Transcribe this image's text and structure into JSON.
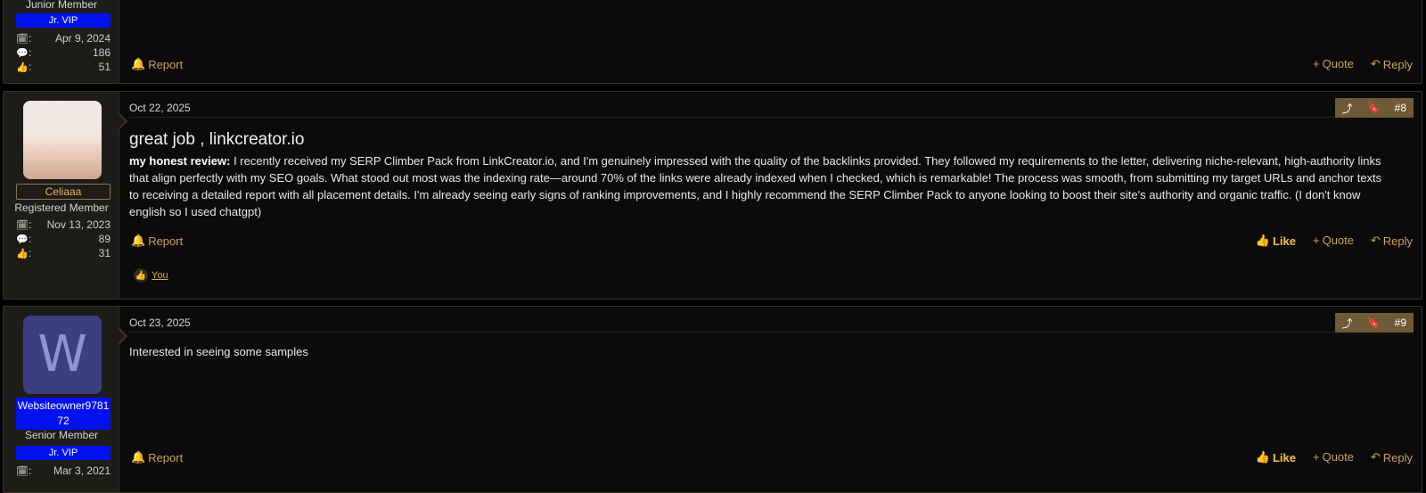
{
  "post_prev": {
    "user": {
      "title": "Junior Member",
      "badge": "Jr. VIP",
      "joined": "Apr 9, 2024",
      "messages": "186",
      "reactions": "51"
    },
    "footer": {
      "report": "Report",
      "quote": "Quote",
      "reply": "Reply"
    }
  },
  "post8": {
    "user": {
      "name": "Celiaaa",
      "title": "Registered Member",
      "joined": "Nov 13, 2023",
      "messages": "89",
      "reactions": "31"
    },
    "date": "Oct 22, 2025",
    "number": "#8",
    "title": "great job , linkcreator.io",
    "body_bold": "my honest review:",
    "body_text": "I recently received my SERP Climber Pack from LinkCreator.io, and I'm genuinely impressed with the quality of the backlinks provided. They followed my requirements to the letter, delivering niche-relevant, high-authority links that align perfectly with my SEO goals. What stood out most was the indexing rate—around 70% of the links were already indexed when I checked, which is remarkable! The process was smooth, from submitting my target URLs and anchor texts to receiving a detailed report with all placement details. I'm already seeing early signs of ranking improvements, and I highly recommend the SERP Climber Pack to anyone looking to boost their site's authority and organic traffic. (I don't know english so I used chatgpt)",
    "footer": {
      "report": "Report",
      "like": "Like",
      "quote": "Quote",
      "reply": "Reply"
    },
    "reaction_user": "You"
  },
  "post9": {
    "user": {
      "avatar_letter": "W",
      "name": "Websiteowner978172",
      "title": "Senior Member",
      "badge": "Jr. VIP",
      "joined": "Mar 3, 2021"
    },
    "date": "Oct 23, 2025",
    "number": "#9",
    "body_text": "Interested in seeing some samples",
    "footer": {
      "report": "Report",
      "like": "Like",
      "quote": "Quote",
      "reply": "Reply"
    }
  }
}
